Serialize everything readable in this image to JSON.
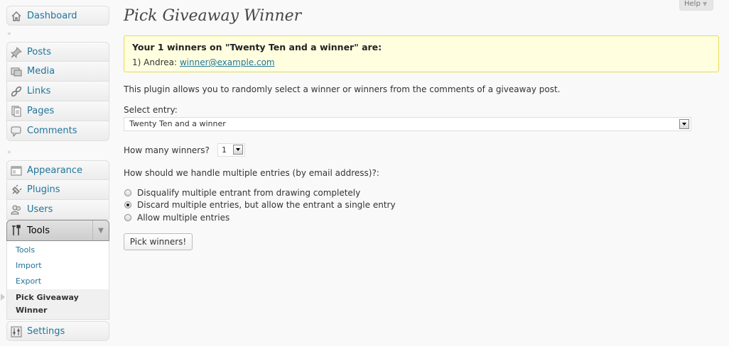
{
  "sidebar": {
    "dashboard": "Dashboard",
    "group1": [
      "Posts",
      "Media",
      "Links",
      "Pages",
      "Comments"
    ],
    "group2": [
      "Appearance",
      "Plugins",
      "Users"
    ],
    "tools": {
      "label": "Tools",
      "submenu": [
        "Tools",
        "Import",
        "Export"
      ],
      "current": "Pick Giveaway Winner"
    },
    "settings": "Settings"
  },
  "help_tab": "Help",
  "page_title": "Pick Giveaway Winner",
  "notice": {
    "title": "Your 1 winners on \"Twenty Ten and a winner\" are:",
    "entry_prefix": "1) Andrea: ",
    "entry_email": "winner@example.com"
  },
  "description": "This plugin allows you to randomly select a winner or winners from the comments of a giveaway post.",
  "select_entry": {
    "label": "Select entry:",
    "value": "Twenty Ten and a winner"
  },
  "winners": {
    "label": "How many winners?",
    "value": "1"
  },
  "multiple": {
    "label": "How should we handle multiple entries (by email address)?:",
    "options": [
      "Disqualify multiple entrant from drawing completely",
      "Discard multiple entries, but allow the entrant a single entry",
      "Allow multiple entries"
    ],
    "selected_index": 1
  },
  "pick_button": "Pick winners!",
  "colors": {
    "link": "#21759b",
    "notice_bg": "#ffffe0",
    "notice_border": "#e6db55"
  }
}
